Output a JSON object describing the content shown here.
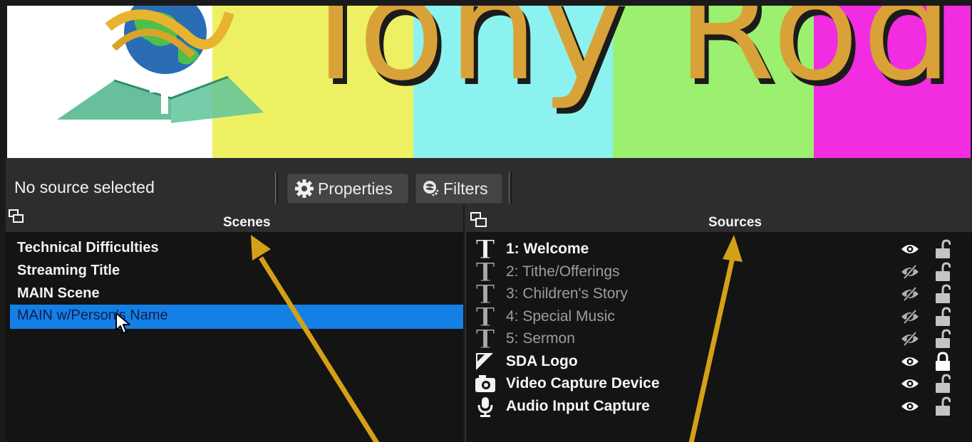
{
  "preview": {
    "title_text": "Tony Rod",
    "bar_colors": [
      "#ffffff",
      "#eef064",
      "#8cf2ef",
      "#9cf070",
      "#f22ce0"
    ],
    "title_color": "#d8a238"
  },
  "toolbar": {
    "status_text": "No source selected",
    "properties_label": "Properties",
    "filters_label": "Filters"
  },
  "scenes": {
    "title": "Scenes",
    "items": [
      {
        "label": "Technical Difficulties",
        "selected": false
      },
      {
        "label": "Streaming Title",
        "selected": false
      },
      {
        "label": "MAIN Scene",
        "selected": false
      },
      {
        "label": "MAIN w/Person's Name",
        "selected": true
      }
    ],
    "selection_color": "#1480e6"
  },
  "sources": {
    "title": "Sources",
    "items": [
      {
        "label": "1: Welcome",
        "icon": "text-icon",
        "visible": true,
        "locked": false
      },
      {
        "label": "2: Tithe/Offerings",
        "icon": "text-icon",
        "visible": false,
        "locked": false
      },
      {
        "label": "3: Children's Story",
        "icon": "text-icon",
        "visible": false,
        "locked": false
      },
      {
        "label": "4: Special Music",
        "icon": "text-icon",
        "visible": false,
        "locked": false
      },
      {
        "label": "5: Sermon",
        "icon": "text-icon",
        "visible": false,
        "locked": false
      },
      {
        "label": "SDA Logo",
        "icon": "image-icon",
        "visible": true,
        "locked": true
      },
      {
        "label": "Video Capture Device",
        "icon": "camera-icon",
        "visible": true,
        "locked": false
      },
      {
        "label": "Audio Input Capture",
        "icon": "microphone-icon",
        "visible": true,
        "locked": false
      }
    ]
  },
  "annotation": {
    "arrow_color": "#d4a017"
  }
}
